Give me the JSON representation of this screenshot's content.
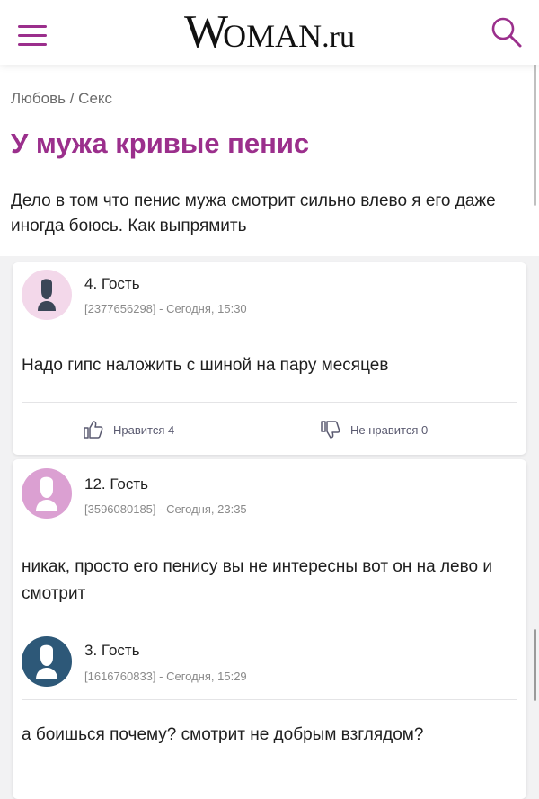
{
  "header": {
    "logo_w": "W",
    "logo_rest": "OMAN",
    "logo_tld": ".ru",
    "menu_icon": "hamburger-menu-icon",
    "search_icon": "search-icon",
    "accent_color": "#9b2f8c"
  },
  "breadcrumb": {
    "item1": "Любовь",
    "separator": " / ",
    "item2": "Секс"
  },
  "article": {
    "title": "У мужа кривые пенис",
    "question": "Дело в том что пенис мужа смотрит сильно влево я его даже иногда боюсь. Как выпрямить"
  },
  "comments": [
    {
      "author": "4. Гость",
      "meta": "[2377656298] - Сегодня, 15:30",
      "text": "Надо гипс наложить с шиной на пару месяцев",
      "avatar_color": "#f3d8ea",
      "avatar_icon": "user-silhouette-icon",
      "likes_label": "Нравится 4",
      "dislikes_label": "Не нравится 0"
    },
    {
      "author": "12. Гость",
      "meta": "[3596080185] - Сегодня, 23:35",
      "text": "никак, просто его пенису вы не интересны вот он на лево и смотрит",
      "avatar_color": "#dba0d2",
      "avatar_icon": "user-silhouette-icon"
    },
    {
      "author": "3. Гость",
      "meta": "[1616760833] - Сегодня, 15:29",
      "text": "а боишься почему? смотрит не добрым взглядом?",
      "avatar_color": "#2d5878",
      "avatar_icon": "user-silhouette-icon"
    }
  ]
}
